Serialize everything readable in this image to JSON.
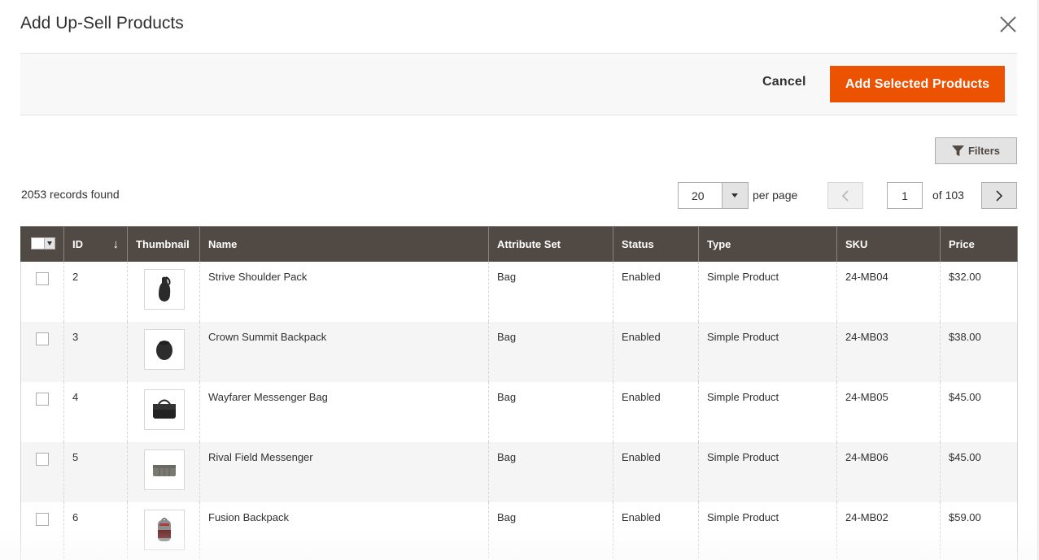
{
  "modal": {
    "title": "Add Up-Sell Products",
    "close_icon": "close-icon"
  },
  "actions": {
    "cancel_label": "Cancel",
    "primary_label": "Add Selected Products",
    "primary_color": "#eb5202"
  },
  "toolbar": {
    "filters_label": "Filters",
    "filters_icon": "filter-funnel-icon",
    "records_found": "2053 records found",
    "per_page_value": "20",
    "per_page_label": "per page",
    "current_page": "1",
    "total_pages_label": "of 103"
  },
  "grid": {
    "header_bg": "#514943",
    "columns": [
      "ID",
      "Thumbnail",
      "Name",
      "Attribute Set",
      "Status",
      "Type",
      "SKU",
      "Price"
    ],
    "sort_indicator": "↓",
    "rows": [
      {
        "id": "2",
        "thumb": "sling-backpack",
        "name": "Strive Shoulder Pack",
        "attribute_set": "Bag",
        "status": "Enabled",
        "type": "Simple Product",
        "sku": "24-MB04",
        "price": "$32.00"
      },
      {
        "id": "3",
        "thumb": "backpack",
        "name": "Crown Summit Backpack",
        "attribute_set": "Bag",
        "status": "Enabled",
        "type": "Simple Product",
        "sku": "24-MB03",
        "price": "$38.00"
      },
      {
        "id": "4",
        "thumb": "messenger-bag",
        "name": "Wayfarer Messenger Bag",
        "attribute_set": "Bag",
        "status": "Enabled",
        "type": "Simple Product",
        "sku": "24-MB05",
        "price": "$45.00"
      },
      {
        "id": "5",
        "thumb": "field-messenger",
        "name": "Rival Field Messenger",
        "attribute_set": "Bag",
        "status": "Enabled",
        "type": "Simple Product",
        "sku": "24-MB06",
        "price": "$45.00"
      },
      {
        "id": "6",
        "thumb": "red-backpack",
        "name": "Fusion Backpack",
        "attribute_set": "Bag",
        "status": "Enabled",
        "type": "Simple Product",
        "sku": "24-MB02",
        "price": "$59.00"
      }
    ]
  }
}
